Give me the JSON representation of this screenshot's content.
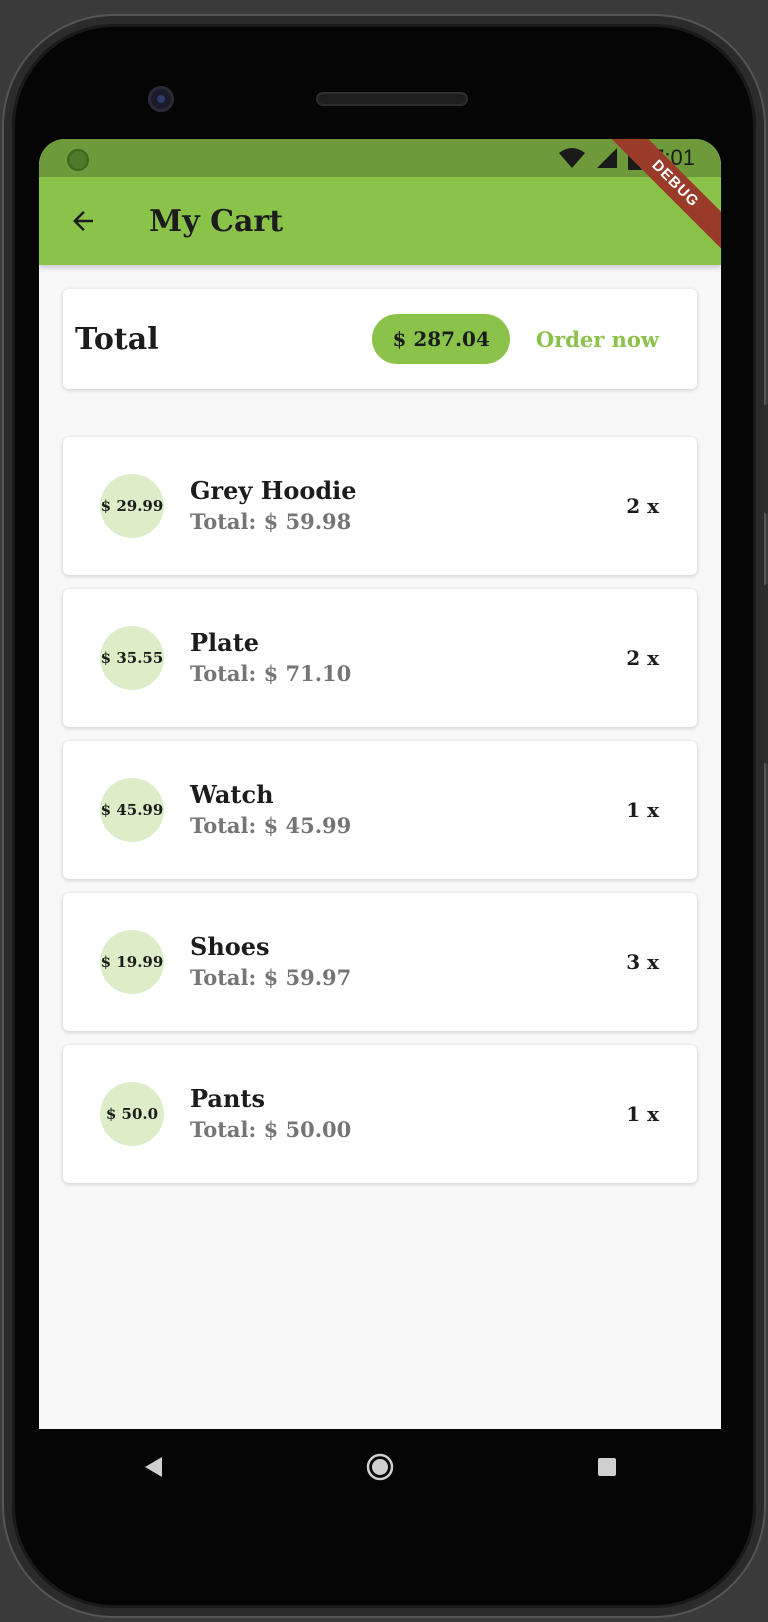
{
  "status_bar": {
    "time": "7:01"
  },
  "debug_banner": "DEBUG",
  "app_bar": {
    "title": "My Cart"
  },
  "summary": {
    "label": "Total",
    "amount": "$ 287.04",
    "order_button": "Order now"
  },
  "items": [
    {
      "name": "Grey Hoodie",
      "price": "$ 29.99",
      "total": "Total: $ 59.98",
      "quantity": "2 x"
    },
    {
      "name": "Plate",
      "price": "$ 35.55",
      "total": "Total: $ 71.10",
      "quantity": "2 x"
    },
    {
      "name": "Watch",
      "price": "$ 45.99",
      "total": "Total: $ 45.99",
      "quantity": "1 x"
    },
    {
      "name": "Shoes",
      "price": "$ 19.99",
      "total": "Total: $ 59.97",
      "quantity": "3 x"
    },
    {
      "name": "Pants",
      "price": "$ 50.0",
      "total": "Total: $ 50.00",
      "quantity": "1 x"
    }
  ],
  "colors": {
    "primary": "#8bc34a",
    "status_bar": "#6e9a3c",
    "avatar_bg": "#dcedc8",
    "secondary_text": "#757575"
  }
}
